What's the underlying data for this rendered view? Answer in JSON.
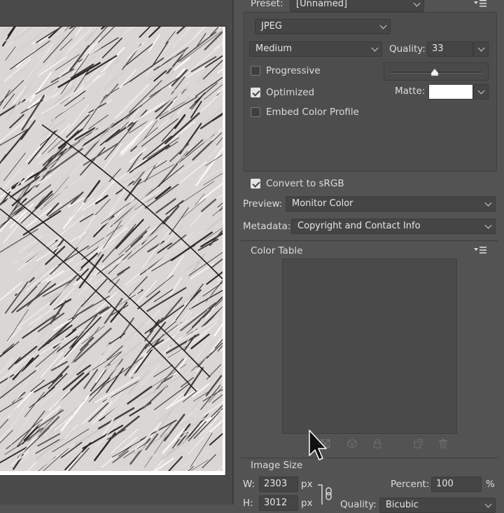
{
  "preset": {
    "label": "Preset:",
    "value": "[Unnamed]"
  },
  "format": {
    "value": "JPEG"
  },
  "compression": {
    "value": "Medium"
  },
  "quality": {
    "label": "Quality:",
    "value": "33",
    "slider_fraction": 0.33
  },
  "options": {
    "progressive": {
      "label": "Progressive",
      "checked": false
    },
    "optimized": {
      "label": "Optimized",
      "checked": true
    },
    "embed_profile": {
      "label": "Embed Color Profile",
      "checked": false
    }
  },
  "matte": {
    "label": "Matte:",
    "color": "#ffffff"
  },
  "convert_srgb": {
    "label": "Convert to sRGB",
    "checked": true
  },
  "preview": {
    "label": "Preview:",
    "value": "Monitor Color"
  },
  "metadata": {
    "label": "Metadata:",
    "value": "Copyright and Contact Info"
  },
  "color_table": {
    "title": "Color Table"
  },
  "image_size": {
    "title": "Image Size",
    "w_label": "W:",
    "w_value": "2303",
    "w_unit": "px",
    "h_label": "H:",
    "h_value": "3012",
    "h_unit": "px",
    "percent_label": "Percent:",
    "percent_value": "100",
    "percent_unit": "%",
    "quality_label": "Quality:",
    "quality_value": "Bicubic"
  },
  "icons": {
    "panel_menu": "panel-menu-icon",
    "color_table_tools": [
      "map-transparency-icon",
      "web-snap-icon",
      "lock-color-icon",
      "new-color-icon",
      "trash-icon"
    ],
    "cursor": "mouse-cursor-icon",
    "link": "link-chain-icon"
  },
  "colors": {
    "panel_bg": "#535353",
    "field_bg": "#454545",
    "text": "#dcdcdc"
  }
}
